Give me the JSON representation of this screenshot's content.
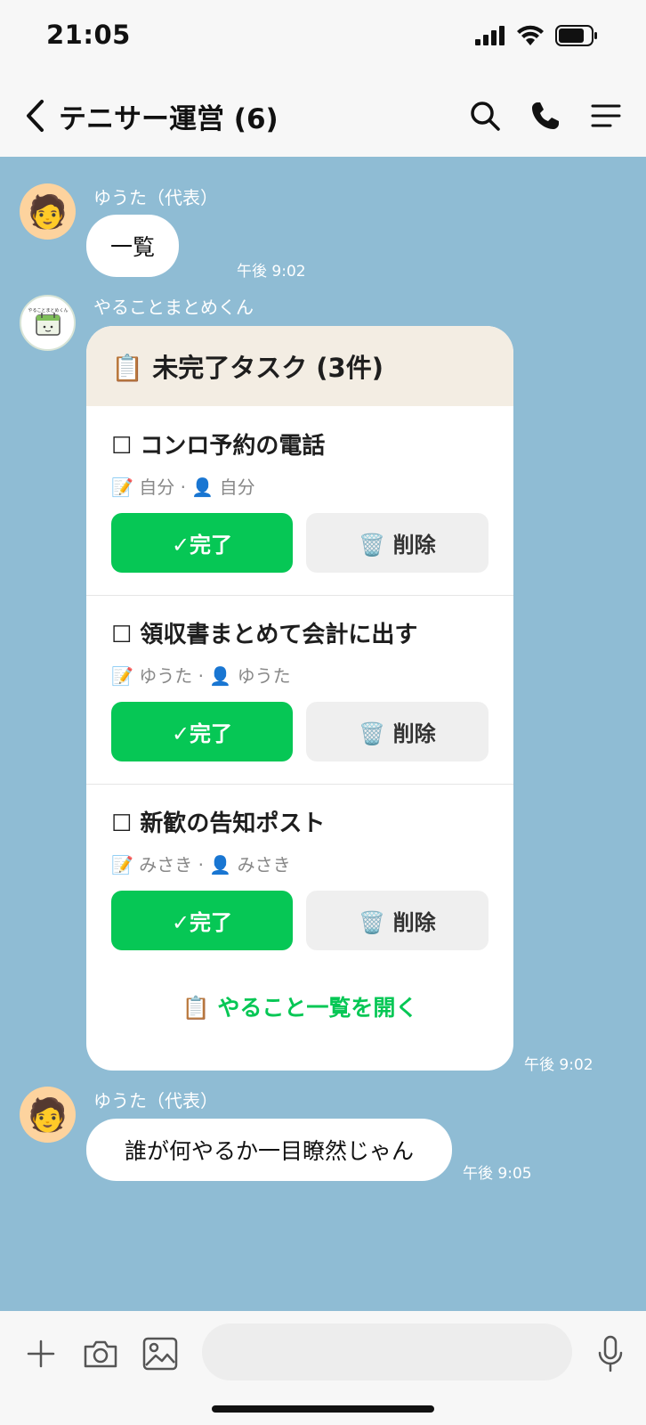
{
  "status_bar": {
    "time": "21:05"
  },
  "header": {
    "title": "テニサー運営 (6)"
  },
  "messages": [
    {
      "sender": "ゆうた（代表）",
      "avatar": "🧑",
      "text": "一覧",
      "time": "午後 9:02"
    },
    {
      "sender": "やることまとめくん",
      "time": "午後 9:02"
    },
    {
      "sender": "ゆうた（代表）",
      "avatar": "🧑",
      "text": "誰が何やるか一目瞭然じゃん",
      "time": "午後 9:05"
    }
  ],
  "card": {
    "title": "📋 未完了タスク (3件)",
    "tasks": [
      {
        "title": "☐ コンロ予約の電話",
        "meta": "📝 自分 · 👤 自分",
        "done_label": "✓完了",
        "delete_label": "🗑️ 削除"
      },
      {
        "title": "☐ 領収書まとめて会計に出す",
        "meta": "📝 ゆうた · 👤 ゆうた",
        "done_label": "✓完了",
        "delete_label": "🗑️ 削除"
      },
      {
        "title": "☐ 新歓の告知ポスト",
        "meta": "📝 みさき · 👤 みさき",
        "done_label": "✓完了",
        "delete_label": "🗑️ 削除"
      }
    ],
    "open_list_label": "📋 やること一覧を開く"
  },
  "bot_avatar": {
    "text": "やることまとめくん"
  },
  "colors": {
    "background": "#8fbcd4",
    "accent_green": "#06c755",
    "bar_background": "#f7f7f7",
    "card_header": "#f3ede3"
  },
  "icons": [
    "back-icon",
    "search-icon",
    "phone-icon",
    "menu-icon",
    "plus-icon",
    "camera-icon",
    "image-icon",
    "microphone-icon",
    "signal-icon",
    "wifi-icon",
    "battery-icon"
  ]
}
